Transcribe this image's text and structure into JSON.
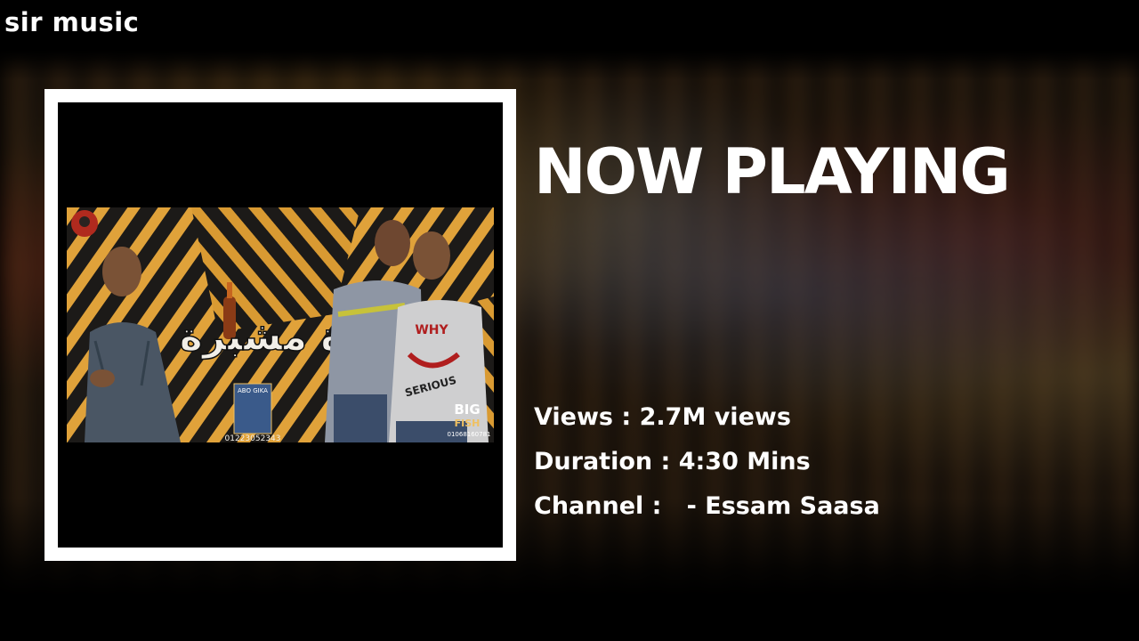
{
  "app": {
    "brand": "sir music"
  },
  "now_playing": {
    "heading": "NOW PLAYING",
    "views_label": "Views : ",
    "views_value": "2.7M views",
    "duration_label": "Duration : ",
    "duration_value": "4:30 Mins",
    "channel_label": "Channel :   ",
    "channel_value": "- Essam Saasa"
  },
  "album_art": {
    "arabic_title": "بيرة مشبرة",
    "badge_top": "BIG",
    "badge_bottom": "FISH",
    "phone_left": "01223052343",
    "phone_right": "01068160781",
    "small_tag": "ABO GIKA",
    "shirt_text_1": "WHY",
    "shirt_text_2": "SERIOUS"
  },
  "colors": {
    "accent": "#ffffff",
    "background": "#000000",
    "art_stripe_gold": "#e0a23a",
    "art_stripe_dark": "#1c1a18"
  }
}
